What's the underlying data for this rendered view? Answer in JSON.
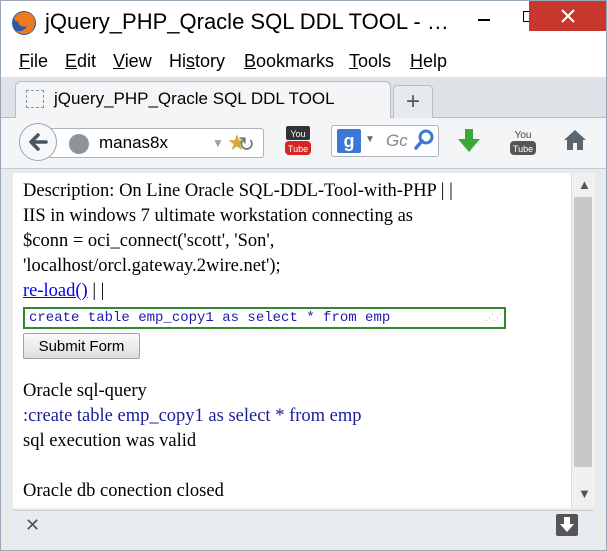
{
  "window": {
    "title": "jQuery_PHP_Qracle SQL DDL TOOL - …"
  },
  "menu": {
    "items": [
      {
        "first": "F",
        "rest": "ile"
      },
      {
        "first": "E",
        "rest": "dit"
      },
      {
        "first": "V",
        "rest": "iew"
      },
      {
        "first": "",
        "mid_pre": "Hi",
        "mid": "s",
        "rest": "tory"
      },
      {
        "first": "B",
        "rest": "ookmarks"
      },
      {
        "first": "T",
        "rest": "ools"
      },
      {
        "first": "H",
        "rest": "elp"
      }
    ]
  },
  "tab": {
    "title": "jQuery_PHP_Qracle SQL DDL TOOL",
    "new_tab": "+"
  },
  "nav": {
    "url": "manas8x",
    "search_placeholder": "Gc",
    "search_engine": "g"
  },
  "content": {
    "desc_line1": "Description: On Line Oracle SQL-DDL-Tool-with-PHP | |",
    "desc_line2": "IIS in windows 7 ultimate workstation connecting as",
    "desc_line3": "$conn = oci_connect('scott', 'Son',",
    "desc_line4": "'localhost/orcl.gateway.2wire.net');",
    "reload_link": "re-load()",
    "reload_sep": " | |",
    "sql_value": "create table emp_copy1 as select * from emp",
    "submit_label": "Submit Form",
    "query_heading": "Oracle sql-query",
    "query_echo": ":create table emp_copy1 as select * from emp",
    "exec_status": "sql execution was valid",
    "conn_status": "Oracle db conection closed"
  },
  "colors": {
    "accent_close": "#c7372d",
    "link": "#0000ee",
    "query_text": "#1c1c99",
    "input_border": "#2f8a2f"
  }
}
